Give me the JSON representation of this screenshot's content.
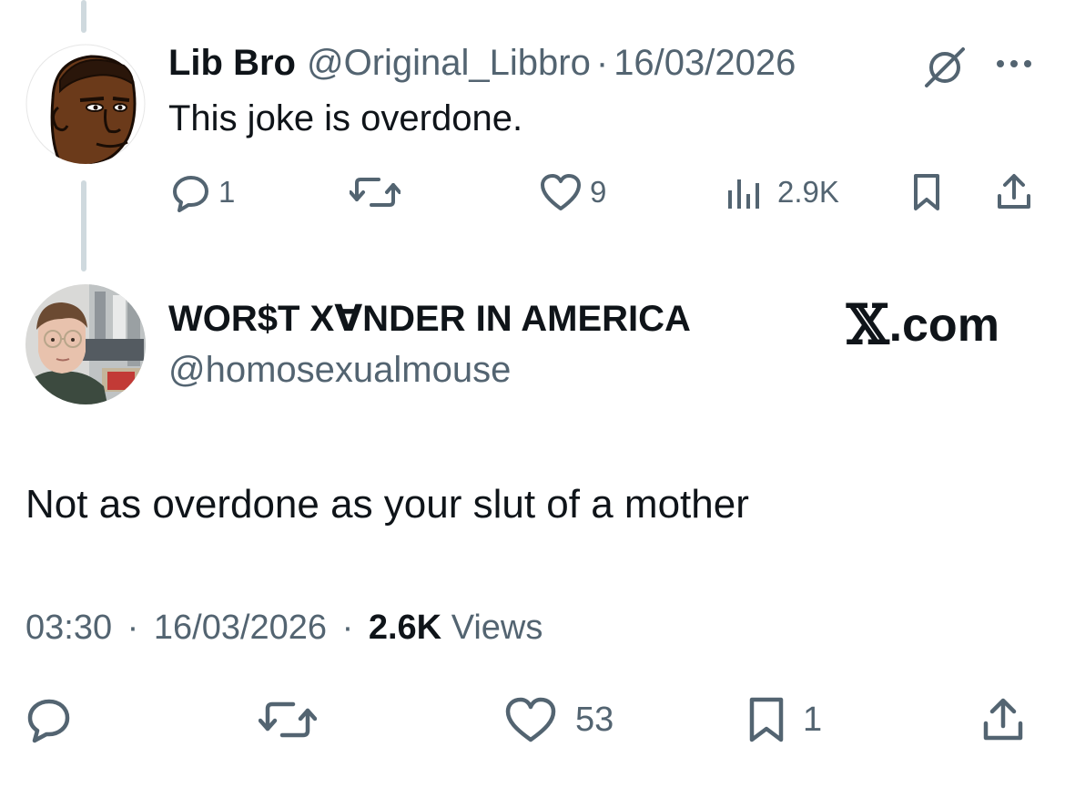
{
  "parent_tweet": {
    "author_name": "Lib Bro",
    "handle": "@Original_Libbro",
    "separator": "·",
    "date": "16/03/2026",
    "text": "This joke is overdone.",
    "icons": {
      "hidden_reply": "slashed-circle-icon",
      "more": "more-dots-icon"
    },
    "actions": {
      "replies": "1",
      "reposts": "",
      "likes": "9",
      "views": "2.9K"
    }
  },
  "main_tweet": {
    "author_name": "WOR$T X∀NDER IN AMERICA",
    "handle": "@homosexualmouse",
    "watermark": {
      "x": "𝕏",
      "suffix": ".com"
    },
    "text": "Not as overdone as your slut of a mother",
    "time": "03:30",
    "separator": "·",
    "date": "16/03/2026",
    "views_count": "2.6K",
    "views_label": "Views",
    "actions": {
      "replies": "",
      "reposts": "",
      "likes": "53",
      "bookmarks": "1"
    }
  },
  "colors": {
    "text_primary": "#0f1419",
    "text_secondary": "#536471",
    "thread_line": "#cfd9de",
    "background": "#ffffff"
  }
}
